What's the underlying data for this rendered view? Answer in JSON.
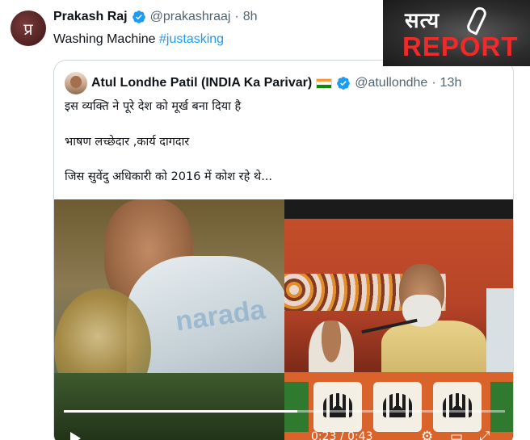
{
  "tweet": {
    "avatar_glyph": "प्र",
    "author_name": "Prakash Raj",
    "handle": "@prakashraaj",
    "separator": "·",
    "time": "8h",
    "text_plain": "Washing Machine ",
    "hashtag": "#justasking"
  },
  "quoted": {
    "author_name": "Atul Londhe Patil (INDIA Ka Parivar)",
    "handle": "@atullondhe",
    "separator": "·",
    "time": "13h",
    "lines": [
      "इस व्यक्ति ने पूरे देश को मूर्ख बना दिया है",
      "भाषण लच्छेदार ,कार्य दागदार",
      "जिस सुवेंदु अधिकारी को 2016 में कोश रहे थे..."
    ],
    "video": {
      "watermark": "narada",
      "time_display": "0:23 / 0:43",
      "progress": 0.53,
      "icons": [
        "play-icon",
        "settings-icon",
        "captions-icon",
        "fullscreen-icon"
      ]
    }
  },
  "overlay_logo": {
    "hindi_text": "सत्य",
    "report_text": "REPORT"
  },
  "colors": {
    "link": "#1d9bf0",
    "verified": "#1d9bf0",
    "muted": "#536471",
    "logo_red": "#ee2a2a"
  }
}
